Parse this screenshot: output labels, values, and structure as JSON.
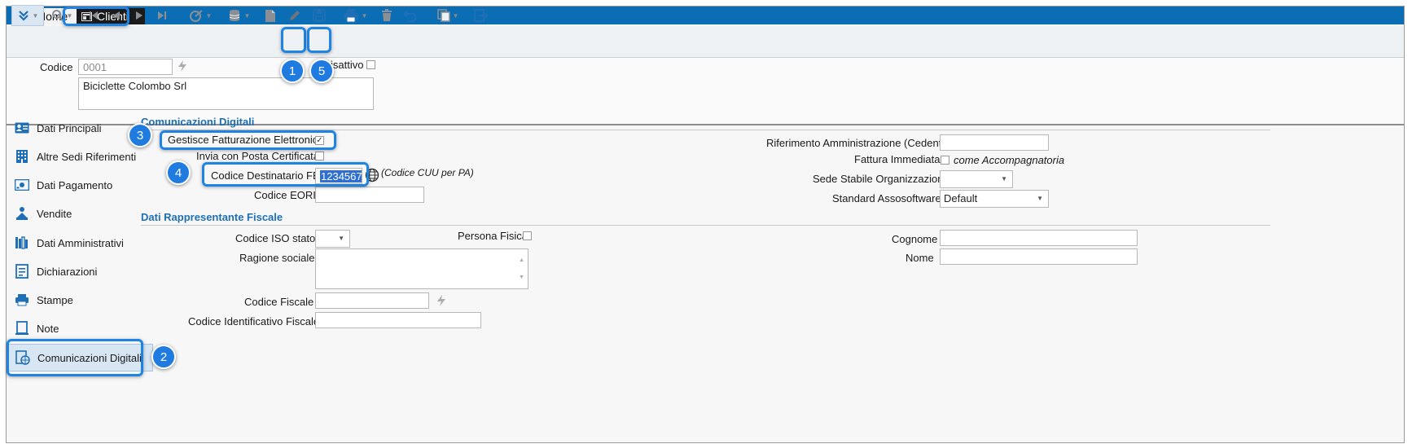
{
  "tabs": {
    "home": "Home",
    "clienti": "Clienti"
  },
  "toolbar": {
    "icons": [
      "expand-icon",
      "search-icon",
      "first-icon",
      "prev-icon",
      "next-icon",
      "last-icon",
      "wand-icon",
      "database-icon",
      "new-document-icon",
      "edit-icon",
      "save-icon",
      "print-icon",
      "delete-icon",
      "undo-icon",
      "copy-icon",
      "exit-icon"
    ]
  },
  "header": {
    "codice_label": "Codice",
    "codice_value": "0001",
    "disattivo_label": "isattivo",
    "ragione_value": "Biciclette Colombo Srl"
  },
  "sidebar": {
    "items": [
      {
        "label": "Dati Principali",
        "icon": "contact-card-icon"
      },
      {
        "label": "Altre Sedi Riferimenti",
        "icon": "building-icon"
      },
      {
        "label": "Dati Pagamento",
        "icon": "payment-icon"
      },
      {
        "label": "Vendite",
        "icon": "sales-icon"
      },
      {
        "label": "Dati Amministrativi",
        "icon": "books-icon"
      },
      {
        "label": "Dichiarazioni",
        "icon": "declaration-icon"
      },
      {
        "label": "Stampe",
        "icon": "printer-icon"
      },
      {
        "label": "Note",
        "icon": "note-icon"
      },
      {
        "label": "Comunicazioni Digitali",
        "icon": "digital-communication-icon"
      }
    ],
    "active_index": 8
  },
  "comunicazioni": {
    "section_title": "Comunicazioni Digitali",
    "gestisce_label": "Gestisce Fatturazione Elettronica",
    "gestisce_checked": true,
    "pec_label": "Invia con Posta Certificata",
    "codice_dest_label": "Codice Destinatario FE",
    "codice_dest_value": "1234567",
    "cuu_note": "(Codice CUU per PA)",
    "eori_label": "Codice EORI",
    "riferimento_label": "Riferimento Amministrazione (Cedente)",
    "fattura_label": "Fattura Immediata",
    "accompagnatoria_label": "come Accompagnatoria",
    "sede_label": "Sede Stabile Organizzazione",
    "standard_label": "Standard Assosoftware",
    "standard_value": "Default"
  },
  "rappresentante": {
    "section_title": "Dati Rappresentante Fiscale",
    "iso_label": "Codice ISO stato",
    "persona_label": "Persona Fisica",
    "ragione_label": "Ragione sociale",
    "cf_label": "Codice Fiscale",
    "cif_label": "Codice Identificativo Fiscale",
    "cognome_label": "Cognome",
    "nome_label": "Nome"
  },
  "callouts": [
    "1",
    "2",
    "3",
    "4",
    "5"
  ],
  "colors": {
    "accent": "#1e84e4",
    "titlebar": "#0b6db4",
    "section": "#1f6fb6"
  }
}
